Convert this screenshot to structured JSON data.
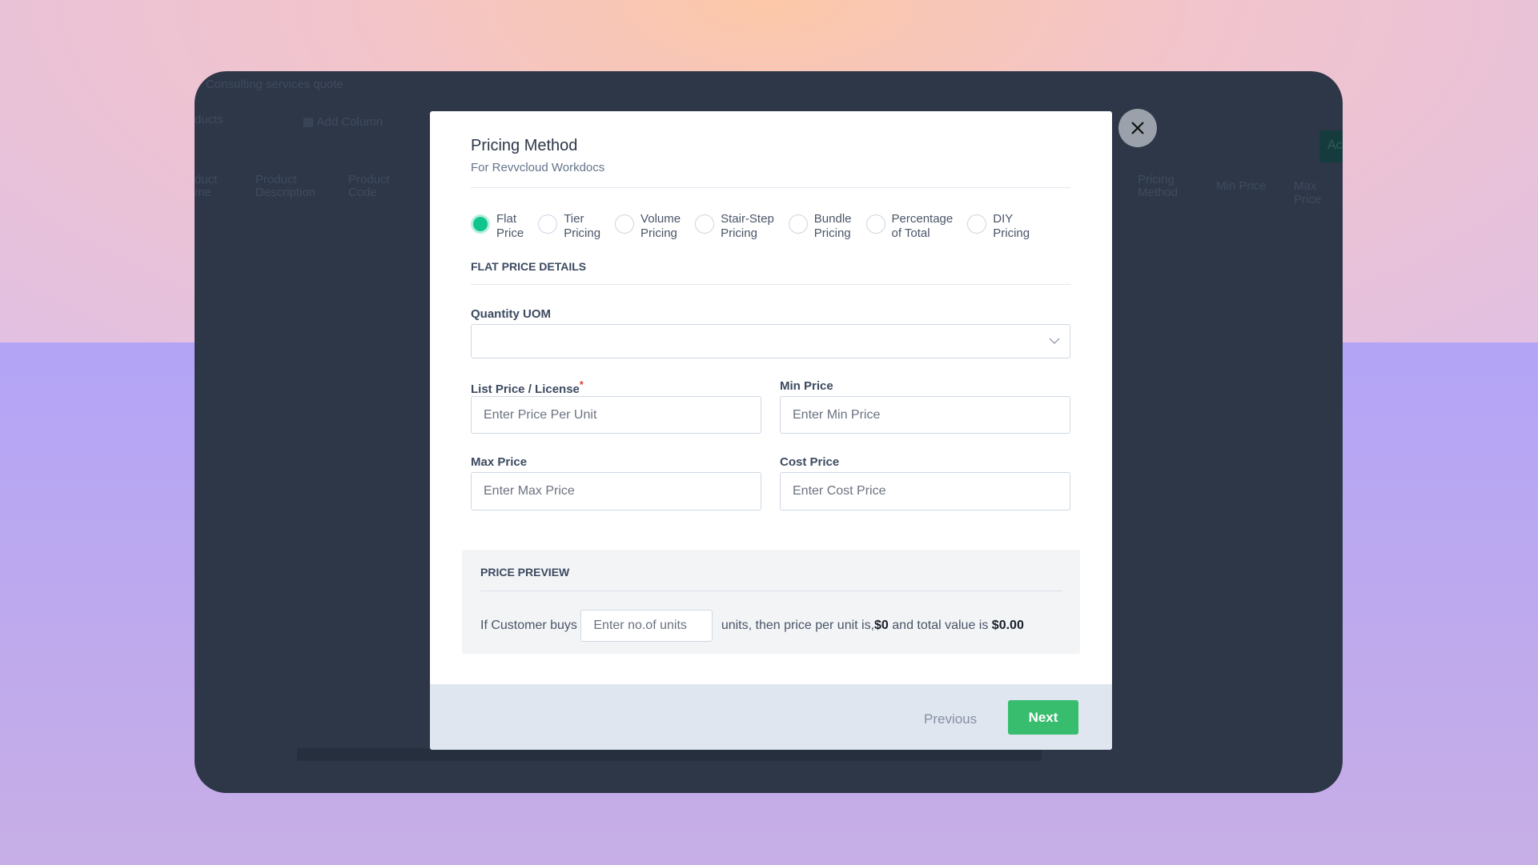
{
  "background_app": {
    "quote_name": "Consulting services quote",
    "products_label": "ducts",
    "add_column": "Add Column",
    "action_button": "Ac",
    "columns": [
      "duct\nme",
      "Product\nDescription",
      "Product\nCode",
      "Pricing\nMethod",
      "Min Price",
      "Max Price"
    ]
  },
  "modal": {
    "title": "Pricing Method",
    "subtitle": "For Revvcloud Workdocs",
    "pricing_options": [
      {
        "label": "Flat\nPrice",
        "selected": true
      },
      {
        "label": "Tier\nPricing",
        "selected": false
      },
      {
        "label": "Volume\nPricing",
        "selected": false
      },
      {
        "label": "Stair-Step\nPricing",
        "selected": false
      },
      {
        "label": "Bundle\nPricing",
        "selected": false
      },
      {
        "label": "Percentage\nof Total",
        "selected": false
      },
      {
        "label": "DIY\nPricing",
        "selected": false
      }
    ],
    "section_title": "FLAT PRICE DETAILS",
    "quantity_uom": {
      "label": "Quantity UOM",
      "value": ""
    },
    "list_price": {
      "label": "List Price / License",
      "required": "*",
      "placeholder": "Enter Price Per Unit"
    },
    "min_price": {
      "label": "Min Price",
      "placeholder": "Enter Min Price"
    },
    "max_price": {
      "label": "Max Price",
      "placeholder": "Enter Max Price"
    },
    "cost_price": {
      "label": "Cost Price",
      "placeholder": "Enter Cost Price"
    },
    "preview": {
      "title": "PRICE PREVIEW",
      "prefix": "If Customer buys ",
      "units_placeholder": "Enter no.of units",
      "middle": " units, then price per unit is,",
      "unit_price": "$0",
      "middle2": " and total value is ",
      "total": "$0.00"
    },
    "footer": {
      "previous": "Previous",
      "next": "Next"
    }
  },
  "colors": {
    "accent": "#38bd6f",
    "radio_selected": "#10c48e",
    "panel": "#2d3748"
  }
}
